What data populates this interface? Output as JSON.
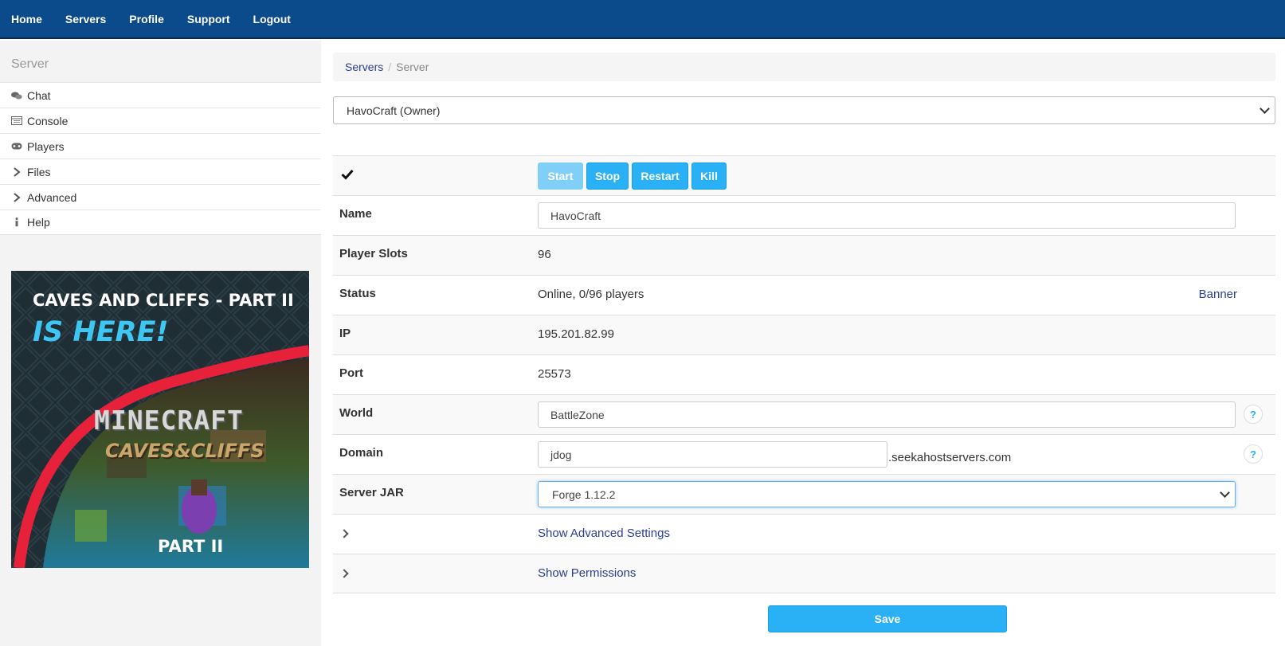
{
  "nav": {
    "items": [
      "Home",
      "Servers",
      "Profile",
      "Support",
      "Logout"
    ]
  },
  "sidebar": {
    "title": "Server",
    "items": [
      {
        "label": "Chat",
        "icon": "chat-icon"
      },
      {
        "label": "Console",
        "icon": "console-icon"
      },
      {
        "label": "Players",
        "icon": "gamepad-icon"
      },
      {
        "label": "Files",
        "icon": "chevron-right-icon"
      },
      {
        "label": "Advanced",
        "icon": "chevron-right-icon"
      },
      {
        "label": "Help",
        "icon": "info-icon"
      }
    ],
    "promo": {
      "line1": "CAVES AND CLIFFS - PART II",
      "line2": "IS HERE!",
      "logo": "MINECRAFT",
      "logo_sub": "CAVES&CLIFFS",
      "footer": "PART II",
      "colors": {
        "bg": "#1c2a30",
        "accent": "#e8213b",
        "cyan": "#3ec7f2"
      }
    }
  },
  "breadcrumb": {
    "link": "Servers",
    "separator": "/",
    "current": "Server"
  },
  "server_select": {
    "value": "HavoCraft (Owner)"
  },
  "controls": {
    "start": "Start",
    "stop": "Stop",
    "restart": "Restart",
    "kill": "Kill",
    "status_icon": "check-icon"
  },
  "fields": {
    "name_label": "Name",
    "name_value": "HavoCraft",
    "slots_label": "Player Slots",
    "slots_value": "96",
    "status_label": "Status",
    "status_value": "Online, 0/96 players",
    "banner_link": "Banner",
    "ip_label": "IP",
    "ip_value": "195.201.82.99",
    "port_label": "Port",
    "port_value": "25573",
    "world_label": "World",
    "world_value": "BattleZone",
    "domain_label": "Domain",
    "domain_value": "jdog",
    "domain_suffix": ".seekahostservers.com",
    "jar_label": "Server JAR",
    "jar_value": "Forge 1.12.2",
    "advanced_link": "Show Advanced Settings",
    "permissions_link": "Show Permissions",
    "help_symbol": "?"
  },
  "save_label": "Save",
  "colors": {
    "nav_bg": "#0b4a8b",
    "button": "#29b0f5",
    "link": "#2a3f8f"
  }
}
